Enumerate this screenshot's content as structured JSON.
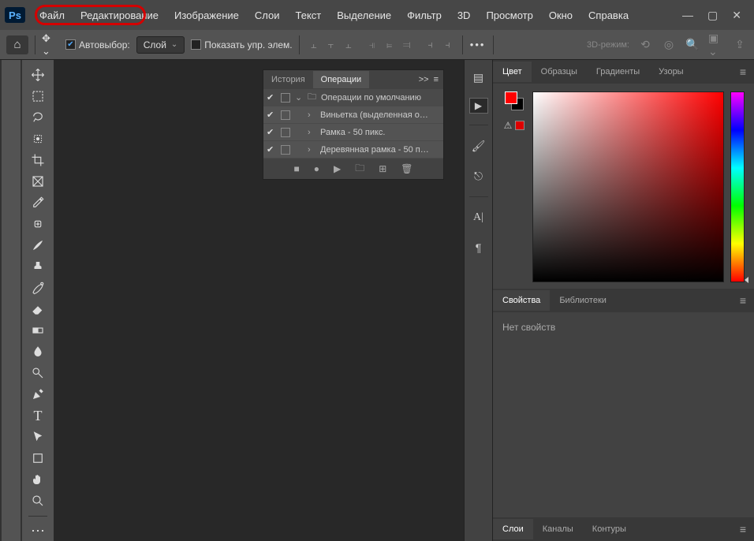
{
  "app": {
    "logo": "Ps"
  },
  "menu": {
    "items": [
      "Файл",
      "Редактирование",
      "Изображение",
      "Слои",
      "Текст",
      "Выделение",
      "Фильтр",
      "3D",
      "Просмотр",
      "Окно",
      "Справка"
    ]
  },
  "options": {
    "autoselect_label": "Автовыбор:",
    "autoselect_value": "Слой",
    "show_controls_label": "Показать упр. элем.",
    "mode3d_label": "3D-режим:"
  },
  "actions_panel": {
    "tab_history": "История",
    "tab_ops": "Операции",
    "collapse": ">>",
    "group_label": "Операции по умолчанию",
    "rows": [
      "Виньетка (выделенная о…",
      "Рамка - 50 пикс.",
      "Деревянная рамка - 50 п…"
    ]
  },
  "color_panel": {
    "tabs": [
      "Цвет",
      "Образцы",
      "Градиенты",
      "Узоры"
    ]
  },
  "props_panel": {
    "tabs": [
      "Свойства",
      "Библиотеки"
    ],
    "empty": "Нет свойств"
  },
  "layers_panel": {
    "tabs": [
      "Слои",
      "Каналы",
      "Контуры"
    ]
  }
}
